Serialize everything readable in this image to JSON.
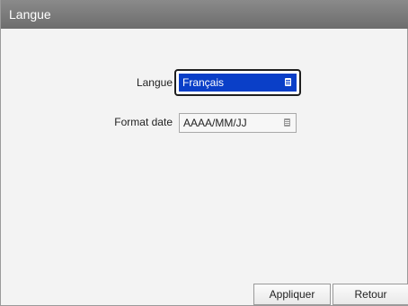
{
  "window": {
    "title": "Langue"
  },
  "form": {
    "language": {
      "label": "Langue",
      "value": "Français",
      "icon": "dropdown-list-icon"
    },
    "date_format": {
      "label": "Format date",
      "value": "AAAA/MM/JJ",
      "icon": "dropdown-list-icon"
    }
  },
  "buttons": {
    "apply": "Appliquer",
    "back": "Retour"
  },
  "colors": {
    "titlebar": "#7a7a7a",
    "selection": "#0a3fc8",
    "background": "#f3f3f3"
  }
}
